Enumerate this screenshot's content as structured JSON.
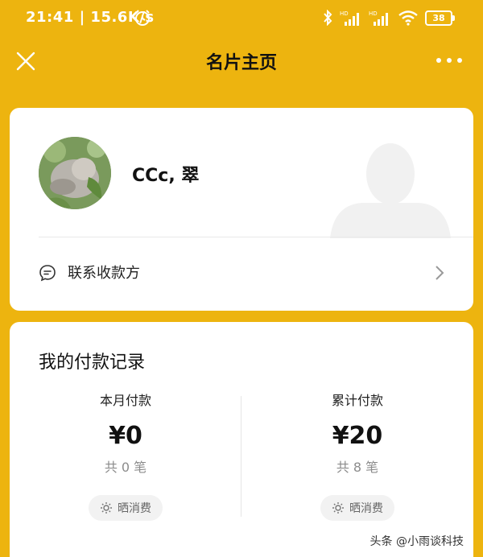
{
  "status_bar": {
    "time": "21:41",
    "speed": "15.6K/s",
    "battery": "38"
  },
  "nav": {
    "title": "名片主页"
  },
  "profile": {
    "name": "CCc, 翠",
    "contact_label": "联系收款方"
  },
  "records": {
    "title": "我的付款记录",
    "columns": [
      {
        "label": "本月付款",
        "amount": "¥0",
        "count": "共 0 笔",
        "share_label": "晒消费"
      },
      {
        "label": "累计付款",
        "amount": "¥20",
        "count": "共 8 笔",
        "share_label": "晒消费"
      }
    ]
  },
  "watermark": "头条 @小雨谈科技",
  "colors": {
    "background": "#EDB40F",
    "card": "#FFFFFF"
  }
}
